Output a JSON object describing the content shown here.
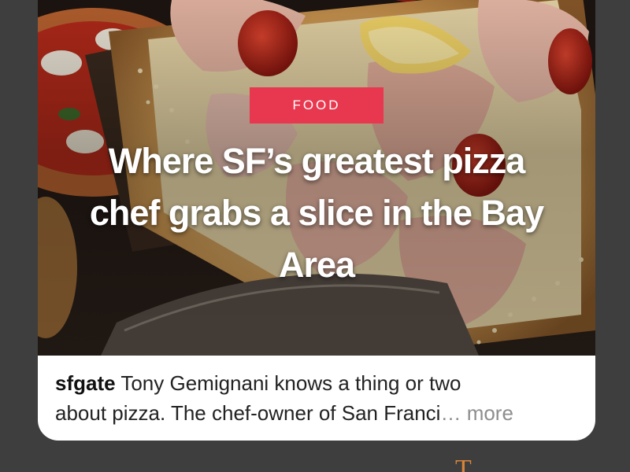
{
  "post": {
    "tag": "FOOD",
    "headline": "Where SF’s greatest pizza chef grabs a slice in the Bay Area",
    "caption": {
      "account": "sfgate",
      "text_line1": " Tony Gemignani knows a thing or two",
      "text_line2": "about pizza. The chef-owner of San Franci",
      "ellipsis": "…",
      "more_label": " more"
    }
  },
  "next_post_peek": {
    "text": "T...."
  },
  "colors": {
    "background": "#3e3e3e",
    "tag": "#e8384f",
    "card": "#ffffff",
    "more_text": "#8e8e8e",
    "peek_text": "#d8843a"
  }
}
